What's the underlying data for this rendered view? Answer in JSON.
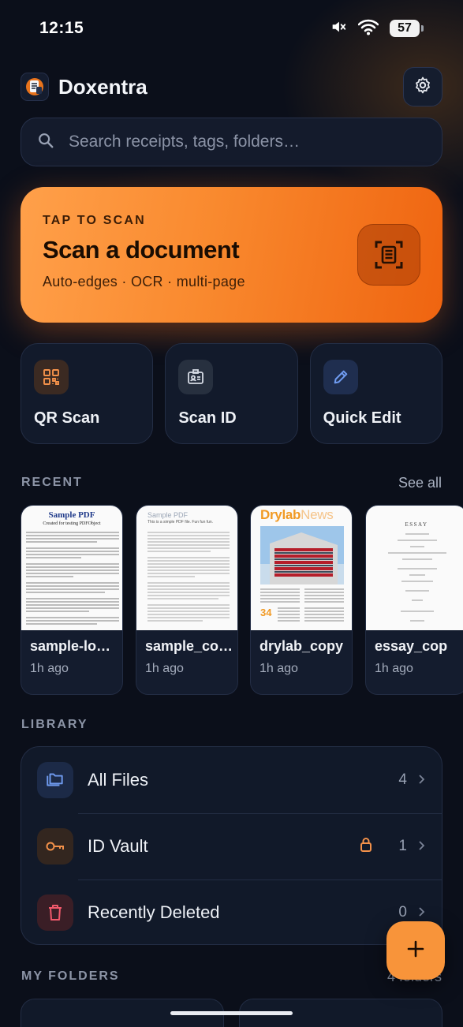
{
  "status_bar": {
    "time": "12:15",
    "battery": "57"
  },
  "header": {
    "app_title": "Doxentra"
  },
  "search": {
    "placeholder": "Search receipts, tags, folders…"
  },
  "scan_card": {
    "eyebrow": "TAP TO SCAN",
    "title": "Scan a document",
    "subtitle": "Auto-edges · OCR · multi-page"
  },
  "tools": [
    {
      "label": "QR Scan",
      "icon": "qr-code-icon"
    },
    {
      "label": "Scan ID",
      "icon": "id-card-icon"
    },
    {
      "label": "Quick Edit",
      "icon": "pencil-icon"
    }
  ],
  "recent": {
    "section_label": "RECENT",
    "see_all_label": "See all",
    "items": [
      {
        "name": "sample-lo…",
        "time": "1h ago",
        "thumb_title": "Sample PDF",
        "thumb_subtitle": "Created for testing PDFObject"
      },
      {
        "name": "sample_co…",
        "time": "1h ago",
        "thumb_title": "Sample PDF",
        "thumb_subtitle": "This is a simple PDF file. Fun fun fun."
      },
      {
        "name": "drylab_copy",
        "time": "1h ago",
        "thumb_title": "Drylab",
        "thumb_title_accent": "News"
      },
      {
        "name": "essay_cop",
        "time": "1h ago",
        "thumb_title": "ESSAY"
      }
    ]
  },
  "library": {
    "section_label": "LIBRARY",
    "items": [
      {
        "label": "All Files",
        "count": "4",
        "icon": "folders-icon"
      },
      {
        "label": "ID Vault",
        "count": "1",
        "icon": "key-icon"
      },
      {
        "label": "Recently Deleted",
        "count": "0",
        "icon": "trash-icon"
      }
    ]
  },
  "my_folders": {
    "section_label": "MY FOLDERS",
    "count_label": "4 folders"
  },
  "colors": {
    "accent": "#f8943a",
    "background": "#0b0f1a",
    "card": "#121a2b"
  }
}
